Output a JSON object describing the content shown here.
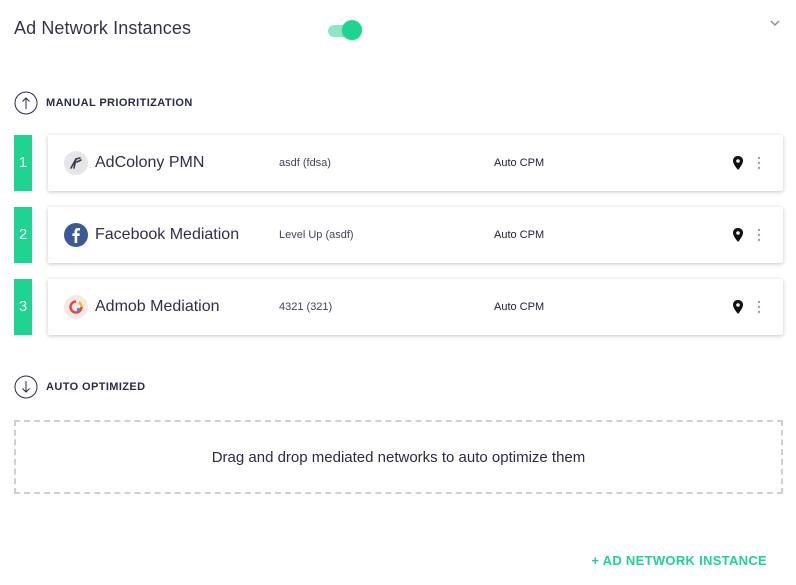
{
  "header": {
    "title": "Ad Network Instances",
    "toggle_on": true,
    "collapse_icon": "chevron-down-icon"
  },
  "sections": {
    "manual": {
      "label": "MANUAL PRIORITIZATION",
      "icon": "arrow-up-circle-icon"
    },
    "auto": {
      "label": "AUTO OPTIMIZED",
      "icon": "arrow-down-circle-icon"
    }
  },
  "instances": [
    {
      "rank": "1",
      "name": "AdColony PMN",
      "id": "asdf (fdsa)",
      "pricing": "Auto CPM",
      "icon": "adcolony-logo-icon"
    },
    {
      "rank": "2",
      "name": "Facebook Mediation",
      "id": "Level Up (asdf)",
      "pricing": "Auto CPM",
      "icon": "facebook-logo-icon"
    },
    {
      "rank": "3",
      "name": "Admob Mediation",
      "id": "4321 (321)",
      "pricing": "Auto CPM",
      "icon": "admob-logo-icon"
    }
  ],
  "dropzone": {
    "text": "Drag and drop mediated networks to auto optimize them"
  },
  "actions": {
    "add_label": "+ AD NETWORK INSTANCE"
  },
  "colors": {
    "accent": "#1fd391",
    "accent_light": "#8de7c4",
    "text": "#2f2f48",
    "facebook": "#3b5998"
  }
}
